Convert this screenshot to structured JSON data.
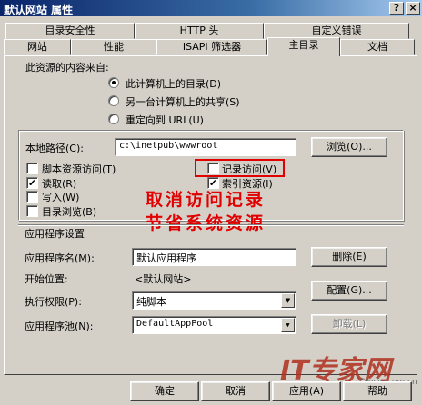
{
  "window": {
    "title": "默认网站 属性",
    "help_btn": "?",
    "close_btn": "×"
  },
  "tabs_row1": [
    "目录安全性",
    "HTTP 头",
    "自定义错误"
  ],
  "tabs_row2": [
    "网站",
    "性能",
    "ISAPI 筛选器",
    "主目录",
    "文档"
  ],
  "content_source": {
    "label": "此资源的内容来自:",
    "options": [
      "此计算机上的目录(D)",
      "另一台计算机上的共享(S)",
      "重定向到 URL(U)"
    ],
    "selected_index": 0
  },
  "local_path": {
    "label": "本地路径(C):",
    "value": "c:\\inetpub\\wwwroot",
    "browse": "浏览(O)..."
  },
  "checkboxes": {
    "script_source": {
      "label": "脚本资源访问(T)",
      "checked": false
    },
    "log_visits": {
      "label": "记录访问(V)",
      "checked": false
    },
    "read": {
      "label": "读取(R)",
      "checked": true
    },
    "index": {
      "label": "索引资源(I)",
      "checked": true
    },
    "write": {
      "label": "写入(W)",
      "checked": false
    },
    "dir_browse": {
      "label": "目录浏览(B)",
      "checked": false
    }
  },
  "annotation": {
    "line1": "取消访问记录",
    "line2": "节省系统资源",
    "color": "#e00000"
  },
  "app_settings": {
    "heading": "应用程序设置",
    "name_label": "应用程序名(M):",
    "name_value": "默认应用程序",
    "remove": "删除(E)",
    "start_label": "开始位置:",
    "start_value": "<默认网站>",
    "config": "配置(G)...",
    "exec_label": "执行权限(P):",
    "exec_value": "纯脚本",
    "pool_label": "应用程序池(N):",
    "pool_value": "DefaultAppPool",
    "unload": "卸载(L)"
  },
  "footer": {
    "ok": "确定",
    "cancel": "取消",
    "apply": "应用(A)",
    "help": "帮助"
  },
  "watermark": {
    "main": "IT专家网",
    "sub": "Ctocio.com.cn"
  },
  "checkmark": "✔",
  "dropdown_arrow": "▼"
}
